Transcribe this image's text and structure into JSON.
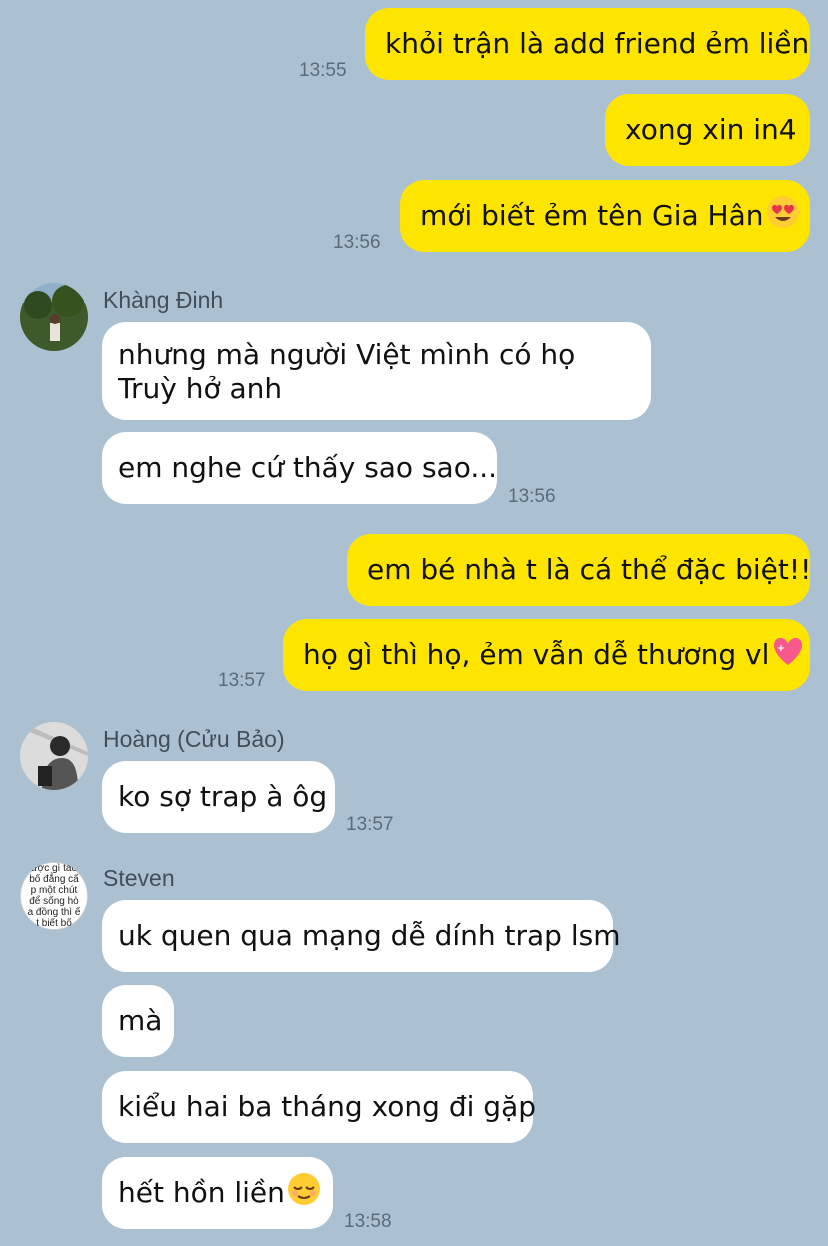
{
  "colors": {
    "background": "#abc1d1",
    "outgoing": "#fee500",
    "incoming": "#ffffff"
  },
  "messages": [
    {
      "text": "khỏi trận là add friend ẻm liền"
    },
    {
      "text": "xong xin in4"
    },
    {
      "text": "mới biết ẻm tên Gia Hân",
      "emoji": "heart-eyes"
    },
    {
      "text": "nhưng mà người Việt mình có họ Truỳ hở anh"
    },
    {
      "text": "em nghe cứ thấy sao sao..."
    },
    {
      "text": "em bé nhà t là cá thể đặc biệt!!"
    },
    {
      "text": "họ gì thì họ, ẻm vẫn dễ thương vl",
      "emoji": "sparkling-heart"
    },
    {
      "text": "ko sợ trap à ôg"
    },
    {
      "text": "uk quen qua mạng dễ dính trap lsm"
    },
    {
      "text": "mà"
    },
    {
      "text": "kiểu hai ba tháng xong đi gặp"
    },
    {
      "text": "hết hồn liền",
      "emoji": "relieved-face"
    }
  ],
  "times": [
    "13:55",
    "13:56",
    "13:56",
    "13:57",
    "13:57",
    "13:58"
  ],
  "senders": {
    "khang": {
      "name": "Khàng Đinh"
    },
    "hoang": {
      "name": "Hoàng (Cửu Bảo)"
    },
    "steven": {
      "name": "Steven",
      "avatar_text": "ược gì tao bố đẳng cấp một chút để sống hòa đồng thì ết biết bố"
    }
  }
}
